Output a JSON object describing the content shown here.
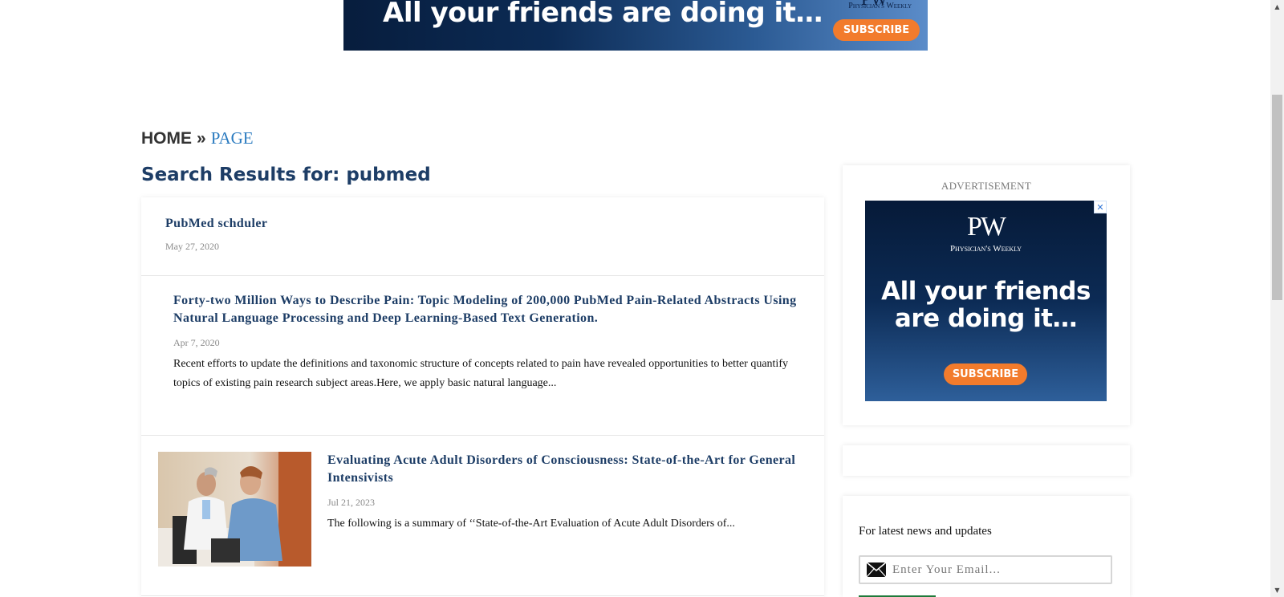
{
  "top_banner": {
    "headline": "All your friends are doing it…",
    "brand_mark": "PW",
    "brand_name": "Physician's Weekly",
    "subscribe_label": "SUBSCRIBE",
    "colors": {
      "background": "#0c2b55",
      "button": "#f27b2c"
    }
  },
  "breadcrumb": {
    "home": "HOME",
    "separator": "»",
    "current": "PAGE"
  },
  "search_title": "Search Results for: pubmed",
  "results": [
    {
      "title": "PubMed schduler",
      "date": "May 27, 2020"
    },
    {
      "title": "Forty-two Million Ways to Describe Pain: Topic Modeling of 200,000 PubMed Pain-Related Abstracts Using Natural Language Processing and Deep Learning-Based Text Generation.",
      "date": "Apr 7, 2020",
      "excerpt": "Recent efforts to update the definitions and taxonomic structure of concepts related to pain have revealed opportunities to better quantify topics of existing pain research subject areas.Here, we apply basic natural language..."
    },
    {
      "title": "Evaluating Acute Adult Disorders of Consciousness: State-of-the-Art for General Intensivists",
      "date": "Jul 21, 2023",
      "excerpt": "The following is a summary of ‘‘State-of-the-Art Evaluation of Acute Adult Disorders of..."
    }
  ],
  "sidebar": {
    "ad_label": "ADVERTISEMENT",
    "ad": {
      "logo": "PW",
      "brand_name": "Physician's Weekly",
      "headline": "All your friends are doing it…",
      "subscribe_label": "SUBSCRIBE",
      "close_icon": "close-icon"
    },
    "newsletter": {
      "label": "For latest news and updates",
      "email_placeholder": "Enter Your Email...",
      "icon": "envelope-icon"
    }
  },
  "colors": {
    "title": "#1d3d66",
    "breadcrumb_link": "#2b7bc0",
    "date": "#8a8a8a"
  }
}
